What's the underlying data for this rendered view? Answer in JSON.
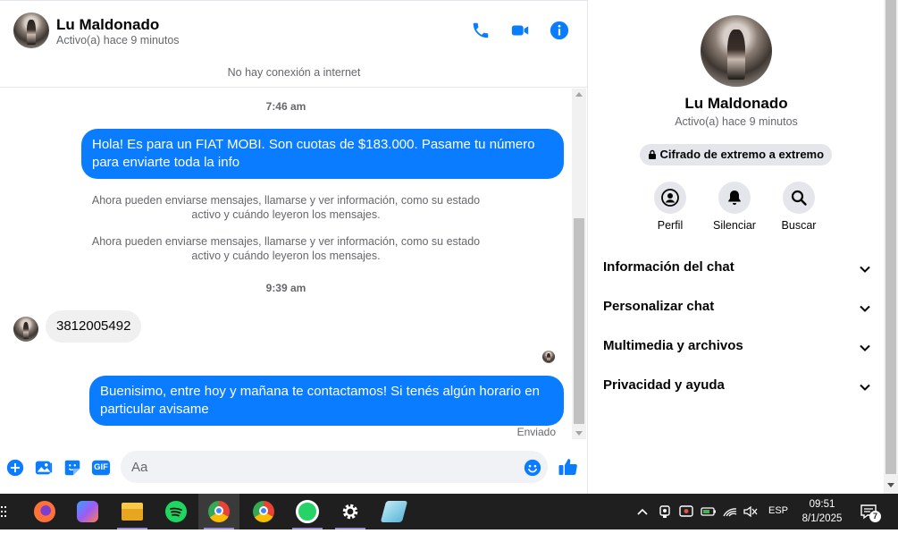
{
  "contact": {
    "name": "Lu Maldonado",
    "status": "Activo(a) hace 9 minutos"
  },
  "connection_notice": "No hay conexión a internet",
  "messages": {
    "ts1": "7:46 am",
    "out1": "Hola! Es para un FIAT MOBI. Son cuotas de $183.000. Pasame tu número para enviarte toda la info",
    "sys1": "Ahora pueden enviarse mensajes, llamarse y ver información, como su estado activo y cuándo leyeron los mensajes.",
    "sys2": "Ahora pueden enviarse mensajes, llamarse y ver información, como su estado activo y cuándo leyeron los mensajes.",
    "ts2": "9:39 am",
    "in1": "3812005492",
    "out2": "Buenisimo, entre hoy y mañana te contactamos! Si tenés algún horario en particular avisame",
    "sent_label": "Enviado"
  },
  "composer": {
    "placeholder": "Aa",
    "gif_label": "GIF"
  },
  "side": {
    "e2e_label": "Cifrado de extremo a extremo",
    "actions": [
      "Perfil",
      "Silenciar",
      "Buscar"
    ],
    "sections": [
      "Información del chat",
      "Personalizar chat",
      "Multimedia y archivos",
      "Privacidad y ayuda"
    ]
  },
  "taskbar": {
    "lang": "ESP",
    "time": "09:51",
    "date": "8/1/2025",
    "notif_count": "7"
  },
  "colors": {
    "accent": "#0a7cff",
    "bubble_in": "#f0f0f0",
    "taskbar": "#1f1f1f"
  }
}
